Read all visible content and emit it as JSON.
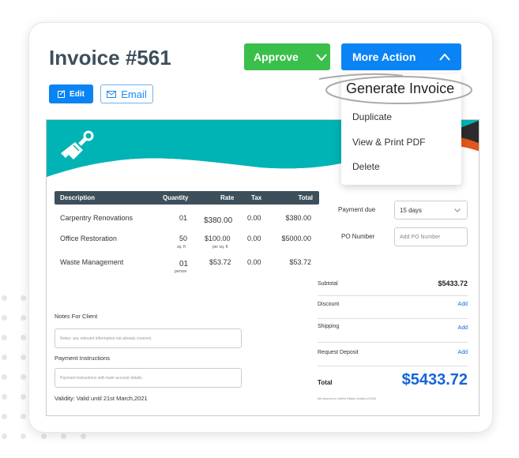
{
  "header": {
    "title": "Invoice #561"
  },
  "actions": {
    "edit": "Edit",
    "email": "Email",
    "approve": "Approve",
    "more_action": "More Action"
  },
  "menu": {
    "items": [
      "Generate Invoice",
      "Duplicate",
      "View & Print PDF",
      "Delete"
    ],
    "highlighted": "Generate Invoice"
  },
  "colors": {
    "teal": "#00b3b5",
    "orange": "#e2571c",
    "dark": "#2c2c2c",
    "primary": "#0a84f4",
    "approve": "#39bf4a",
    "table_header": "#3e4f5c",
    "total": "#1565d8"
  },
  "table": {
    "headers": [
      "Description",
      "Quantity",
      "Rate",
      "Tax",
      "Total"
    ],
    "rows": [
      {
        "description": "Carpentry Renovations",
        "quantity": "01",
        "quantity_unit": "",
        "rate": "$380.00",
        "rate_unit": "",
        "tax": "0.00",
        "total": "$380.00"
      },
      {
        "description": "Office Restoration",
        "quantity": "50",
        "quantity_unit": "sq. ft",
        "rate": "$100.00",
        "rate_unit": "per sq. ft",
        "tax": "0.00",
        "total": "$5000.00"
      },
      {
        "description": "Waste Management",
        "quantity": "01",
        "quantity_unit": "person",
        "rate": "$53.72",
        "rate_unit": "",
        "tax": "0.00",
        "total": "$53.72"
      }
    ]
  },
  "payment_due": {
    "label": "Payment due",
    "value": "15 days"
  },
  "po_number": {
    "label": "PO Number",
    "placeholder": "Add PO Number"
  },
  "notes": {
    "label": "Notes For Client",
    "placeholder": "Notes- any relevant information not already covered."
  },
  "payment_instructions": {
    "label": "Payment Instructions",
    "placeholder": "Payment instructions with bank account details."
  },
  "validity": "Validity: Valid until 21st March,2021",
  "summary": {
    "subtotal_label": "Subtotal",
    "subtotal": "$5433.72",
    "discount_label": "Discount",
    "shipping_label": "Shipping",
    "deposit_label": "Request Deposit",
    "add_label": "Add",
    "total_label": "Total",
    "total": "$5433.72",
    "currency_note": "All amount in United States Dollars (USD)"
  }
}
